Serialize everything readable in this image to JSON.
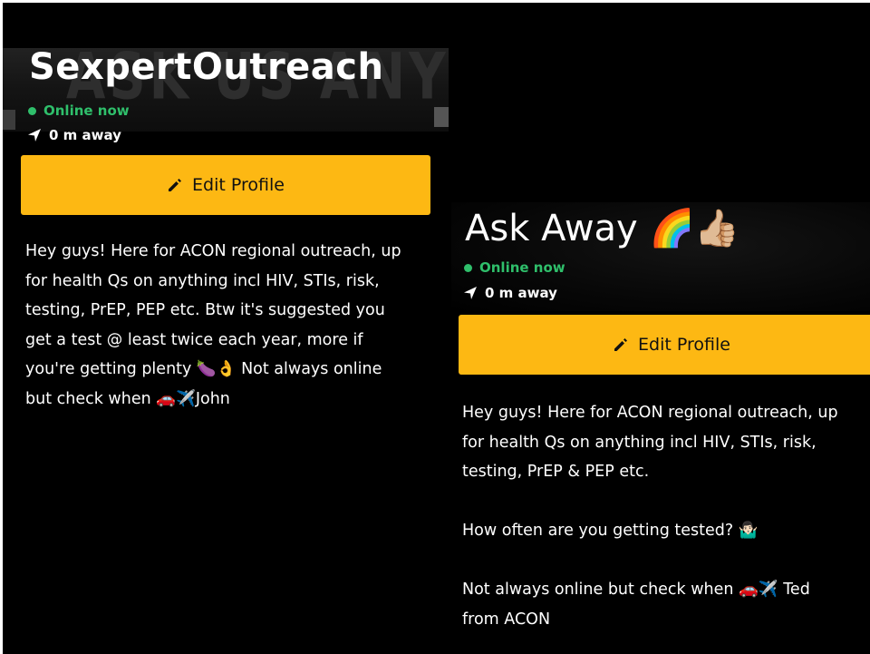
{
  "left_profile": {
    "banner_watermark": "ASK US ANYTHING",
    "display_name": "SexpertOutreach",
    "status": "Online now",
    "distance": "0 m away",
    "edit_button_label": "Edit Profile",
    "bio": "Hey guys! Here for ACON regional outreach, up\nfor health Qs on anything incl HIV, STIs, risk,\ntesting, PrEP, PEP etc. Btw it's suggested you\nget a test @ least twice each year, more if\nyou're getting plenty 🍆👌 Not always online\nbut check when 🚗✈️John"
  },
  "right_profile": {
    "display_name": "Ask Away 🌈👍🏼",
    "status": "Online now",
    "distance": "0 m away",
    "edit_button_label": "Edit Profile",
    "bio": "Hey guys! Here for ACON regional outreach, up\nfor health Qs on anything incl HIV, STIs, risk,\ntesting, PrEP & PEP etc.\n\nHow often are you getting tested? 🤷🏻‍♂️\n\nNot always online but check when 🚗✈️ Ted\nfrom ACON"
  },
  "colors": {
    "accent_button": "#fdb813",
    "online_green": "#2fbf6b",
    "background": "#000000",
    "text": "#ffffff"
  },
  "icons": [
    "location-arrow-icon",
    "pencil-icon",
    "online-dot-icon"
  ]
}
